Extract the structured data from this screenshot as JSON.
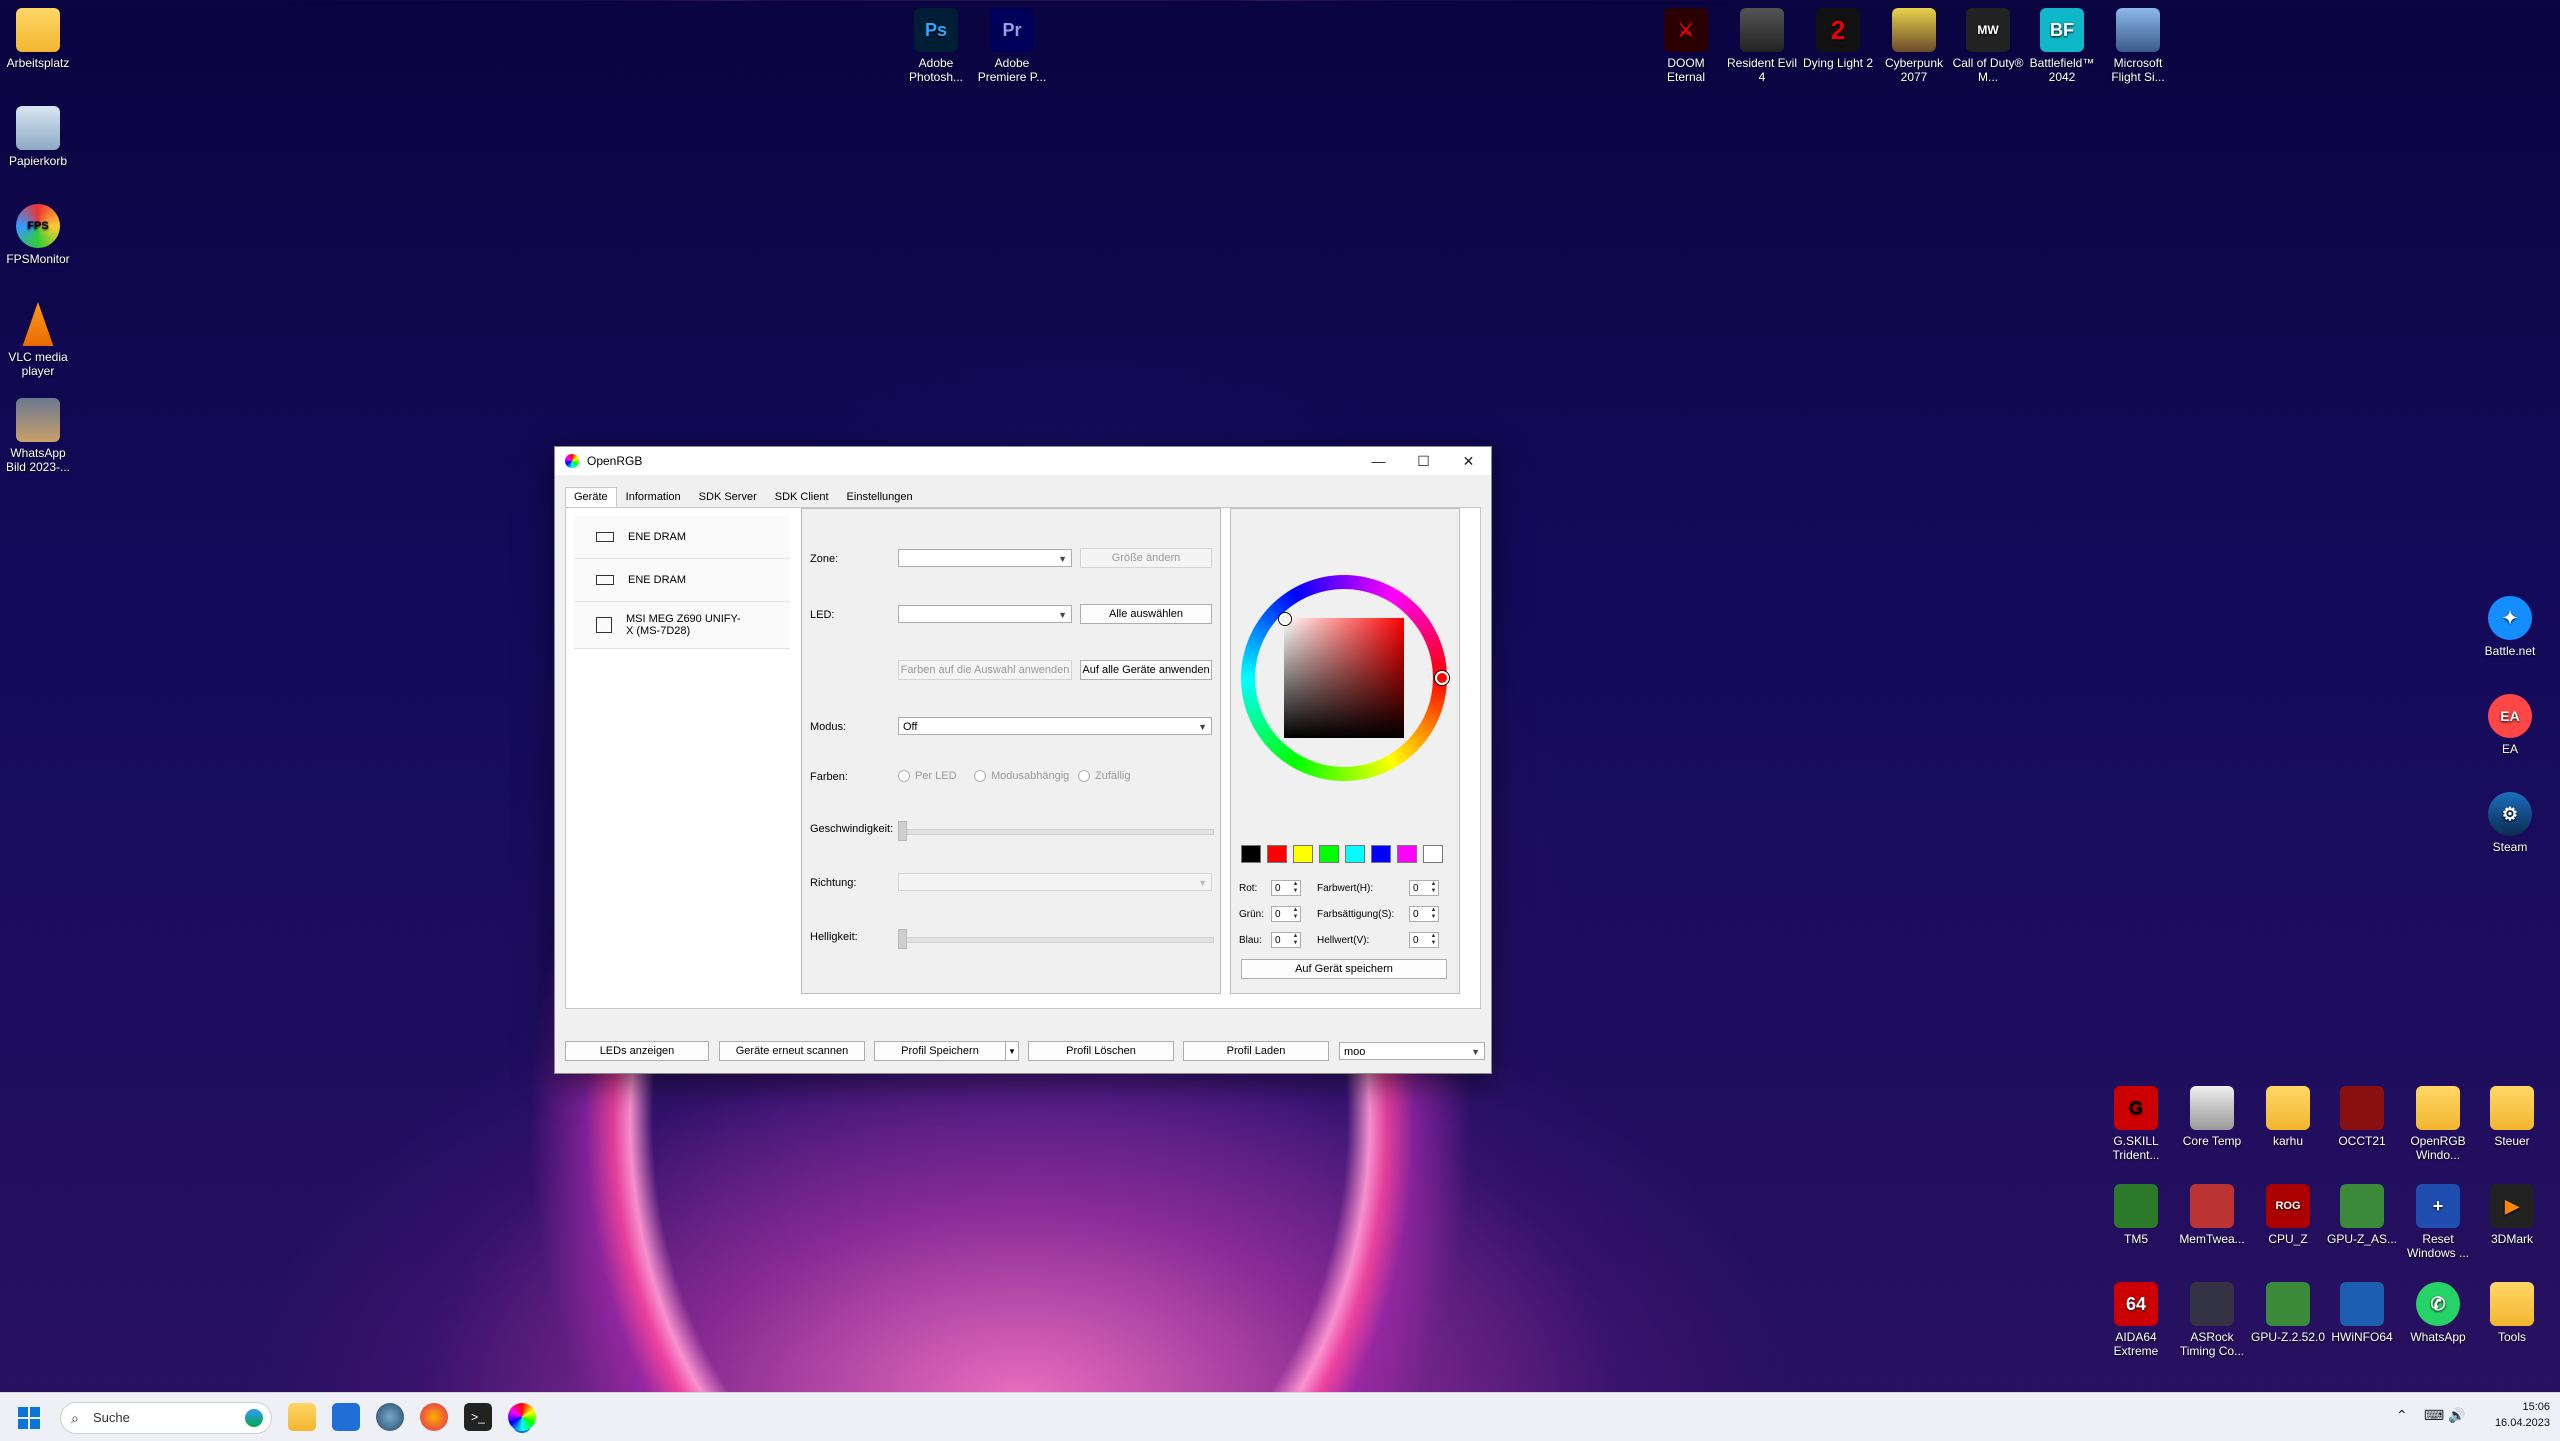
{
  "desktop_left": [
    "Arbeitsplatz",
    "Papierkorb",
    "FPSMonitor",
    "VLC media player",
    "WhatsApp Bild 2023-..."
  ],
  "desktop_top_mid": [
    "Adobe Photosh...",
    "Adobe Premiere P..."
  ],
  "desktop_top_mid_glyphs": [
    "Ps",
    "Pr"
  ],
  "desktop_top_right": [
    "DOOM Eternal",
    "Resident Evil 4",
    "Dying Light 2",
    "Cyberpunk 2077",
    "Call of Duty® M...",
    "Battlefield™ 2042",
    "Microsoft Flight Si..."
  ],
  "desktop_right": [
    "Battle.net",
    "EA",
    "Steam"
  ],
  "desktop_bottom_rows": [
    [
      "G.SKILL Trident...",
      "Core Temp",
      "karhu",
      "OCCT21",
      "OpenRGB Windo...",
      "Steuer"
    ],
    [
      "TM5",
      "MemTwea...",
      "CPU_Z",
      "GPU-Z_AS...",
      "Reset Windows ...",
      "3DMark"
    ],
    [
      "AIDA64 Extreme",
      "ASRock Timing Co...",
      "GPU-Z.2.52.0",
      "HWiNFO64",
      "WhatsApp",
      "Tools"
    ]
  ],
  "window": {
    "title": "OpenRGB",
    "tabs": [
      "Geräte",
      "Information",
      "SDK Server",
      "SDK Client",
      "Einstellungen"
    ],
    "devices": [
      "ENE DRAM",
      "ENE DRAM",
      "MSI MEG Z690 UNIFY-X (MS-7D28)"
    ],
    "controls": {
      "zone_label": "Zone:",
      "resize_button": "Größe ändern",
      "led_label": "LED:",
      "select_all_button": "Alle auswählen",
      "apply_selection_button": "Farben auf die Auswahl anwenden",
      "apply_all_button": "Auf alle Geräte anwenden",
      "mode_label": "Modus:",
      "mode_value": "Off",
      "colors_label": "Farben:",
      "radio_per_led": "Per LED",
      "radio_mode": "Modusabhängig",
      "radio_random": "Zufällig",
      "speed_label": "Geschwindigkeit:",
      "direction_label": "Richtung:",
      "brightness_label": "Helligkeit:"
    },
    "color": {
      "swatches": [
        "#000000",
        "#ff0000",
        "#ffff00",
        "#00ff00",
        "#00ffff",
        "#0000ff",
        "#ff00ff",
        "#ffffff"
      ],
      "red_label": "Rot:",
      "red_value": "0",
      "green_label": "Grün:",
      "green_value": "0",
      "blue_label": "Blau:",
      "blue_value": "0",
      "hue_label": "Farbwert(H):",
      "hue_value": "0",
      "sat_label": "Farbsättigung(S):",
      "sat_value": "0",
      "val_label": "Hellwert(V):",
      "val_value": "0",
      "save_button": "Auf Gerät speichern"
    },
    "bottom": {
      "show_leds": "LEDs anzeigen",
      "rescan": "Geräte erneut scannen",
      "save_profile": "Profil Speichern",
      "delete_profile": "Profil Löschen",
      "load_profile": "Profil Laden",
      "profile_value": "moo"
    }
  },
  "taskbar": {
    "search_placeholder": "Suche",
    "time": "15:06",
    "date": "16.04.2023"
  }
}
